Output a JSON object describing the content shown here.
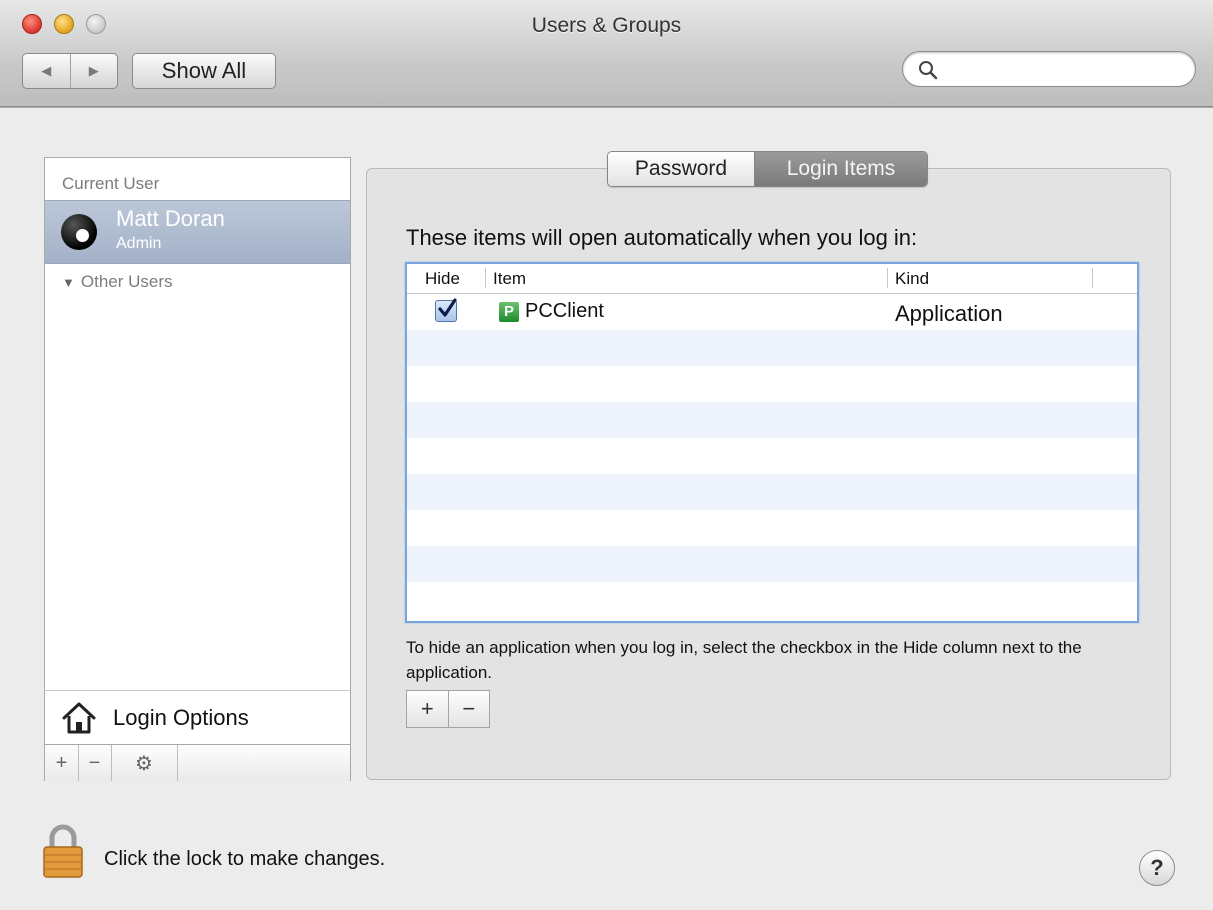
{
  "window": {
    "title": "Users & Groups",
    "back_glyph": "◀",
    "forward_glyph": "▶",
    "show_all_label": "Show All",
    "search_placeholder": ""
  },
  "sidebar": {
    "current_user_header": "Current User",
    "current_user": {
      "name": "Matt Doran",
      "role": "Admin"
    },
    "other_users_label": "Other Users",
    "login_options_label": "Login Options",
    "add_glyph": "+",
    "remove_glyph": "−",
    "action_glyph": "⚙"
  },
  "tabs": [
    {
      "label": "Password",
      "selected": false
    },
    {
      "label": "Login Items",
      "selected": true
    }
  ],
  "login_items": {
    "heading": "These items will open automatically when you log in:",
    "columns": {
      "hide": "Hide",
      "item": "Item",
      "kind": "Kind"
    },
    "rows": [
      {
        "hide": true,
        "item": "PCClient",
        "icon": "pcclient-app-icon",
        "icon_letter": "P",
        "kind": "Application"
      }
    ],
    "hint": "To hide an application when you log in, select the checkbox in the Hide column next to the application.",
    "add_glyph": "+",
    "remove_glyph": "−"
  },
  "footer": {
    "lock_text": "Click the lock to make changes.",
    "help_glyph": "?"
  },
  "colors": {
    "selection": "#a3b1c8",
    "table_focus_border": "#7aa4dc",
    "selected_tab": "#7a7a7a"
  }
}
